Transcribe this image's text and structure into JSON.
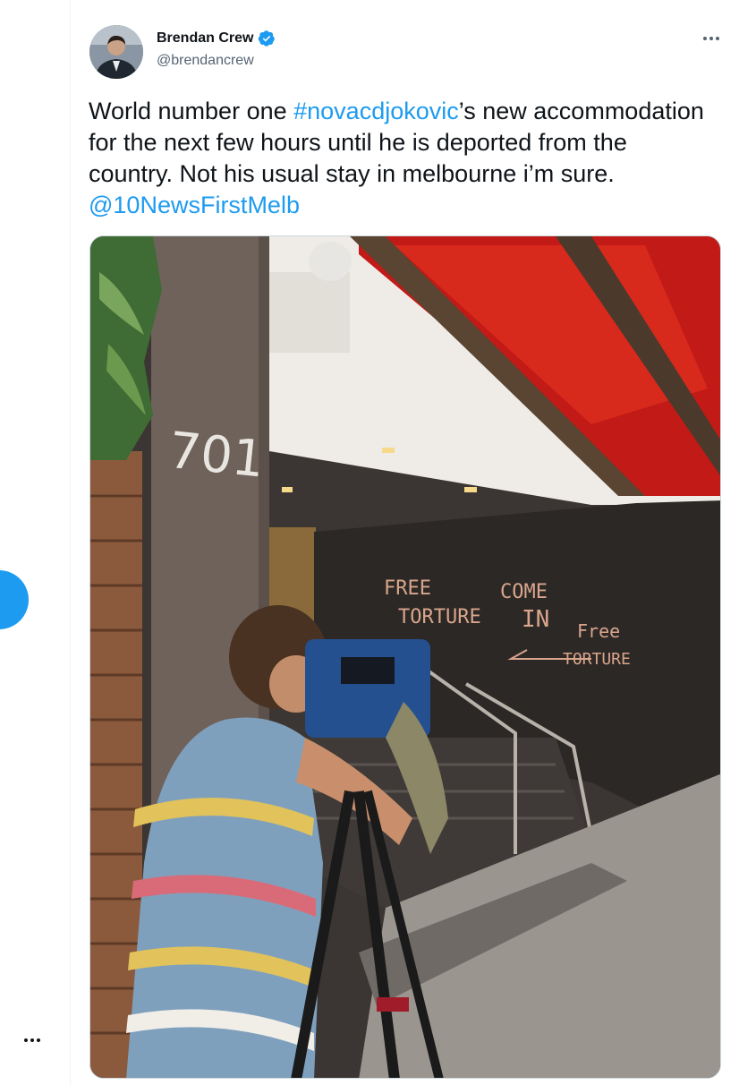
{
  "user": {
    "display_name": "Brendan Crew",
    "handle": "@brendancrew",
    "verified": true
  },
  "tweet": {
    "segments": [
      {
        "text": "World number one ",
        "link": false
      },
      {
        "text": "#novacdjokovic",
        "link": true
      },
      {
        "text": "’s new accommodation for the next few hours until he is deported from the country. Not his usual stay in melbourne i’m sure. ",
        "link": false
      },
      {
        "text": "@10NewsFirstMelb",
        "link": true
      }
    ]
  },
  "photo": {
    "building_number": "701",
    "wall_graffiti": [
      "FREE",
      "TORTURE",
      "COME",
      "IN",
      "Free",
      "TORTURE"
    ]
  },
  "colors": {
    "accent": "#1d9bf0",
    "text_primary": "#0f1419",
    "text_secondary": "#536471"
  },
  "icons": {
    "verified": "verified-badge-icon",
    "more": "more-dots-icon",
    "compose": "compose-button"
  }
}
